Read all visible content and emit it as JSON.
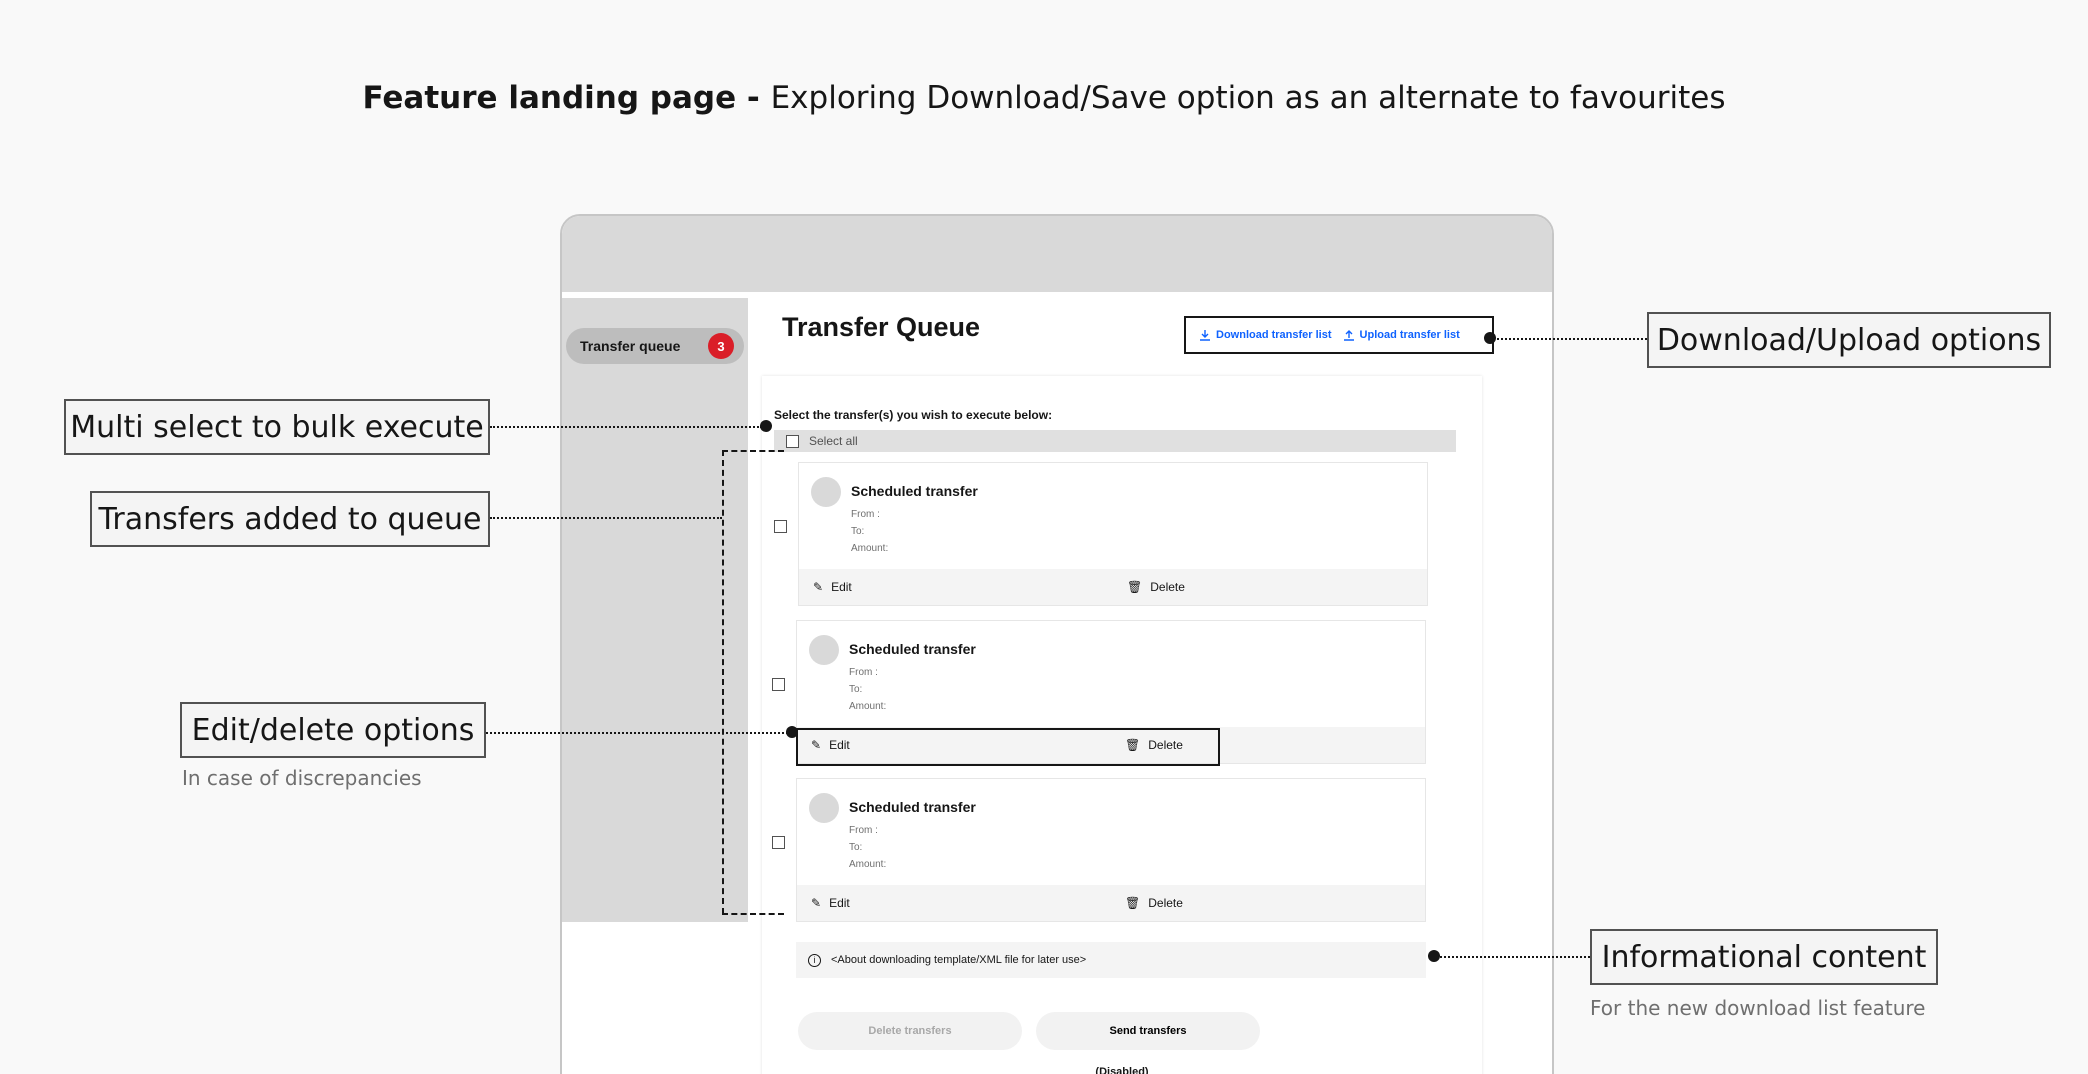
{
  "page_title": {
    "bold": "Feature landing page - ",
    "rest": "Exploring Download/Save option as an alternate to favourites"
  },
  "sidebar": {
    "item_label": "Transfer queue",
    "badge_count": "3"
  },
  "main": {
    "title": "Transfer Queue",
    "download_label": "Download transfer list",
    "upload_label": "Upload transfer list",
    "instruction": "Select the transfer(s)  you wish to execute below:",
    "select_all": "Select all",
    "cards": [
      {
        "title": "Scheduled transfer",
        "from": "From :",
        "to": "To:",
        "amount": "Amount:",
        "edit": "Edit",
        "delete": "Delete"
      },
      {
        "title": "Scheduled transfer",
        "from": "From :",
        "to": "To:",
        "amount": "Amount:",
        "edit": "Edit",
        "delete": "Delete"
      },
      {
        "title": "Scheduled transfer",
        "from": "From :",
        "to": "To:",
        "amount": "Amount:",
        "edit": "Edit",
        "delete": "Delete"
      }
    ],
    "info_text": "<About downloading template/XML file for later use>",
    "delete_transfers": "Delete transfers",
    "send_transfers": "Send transfers",
    "disabled_note": "(Disabled)"
  },
  "annotations": {
    "download_upload": "Download/Upload options",
    "multi_select": "Multi select to bulk execute",
    "transfers_added": "Transfers added to queue",
    "edit_delete": "Edit/delete options",
    "edit_delete_note": "In case of discrepancies",
    "info_content": "Informational content",
    "info_note": "For the new download list feature"
  },
  "colors": {
    "badge": "#da1e28",
    "link": "#0f62fe",
    "sidebar": "#d9d9d9"
  },
  "icons": [
    "download-icon",
    "upload-icon",
    "edit-icon",
    "delete-icon",
    "info-icon"
  ]
}
